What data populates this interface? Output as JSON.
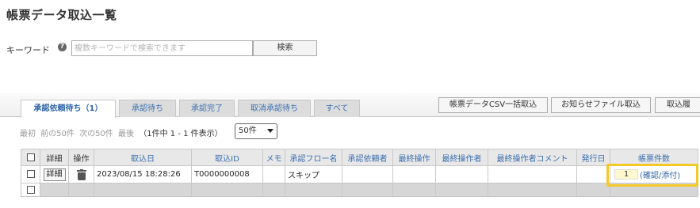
{
  "page": {
    "title": "帳票データ取込一覧"
  },
  "search": {
    "label": "キーワード",
    "help_icon": "?",
    "placeholder": "複数キーワードで検索できます",
    "button": "検索"
  },
  "tabs": [
    {
      "label": "承認依頼待ち（1）",
      "active": true
    },
    {
      "label": "承認待ち",
      "active": false
    },
    {
      "label": "承認完了",
      "active": false
    },
    {
      "label": "取消承認待ち",
      "active": false
    },
    {
      "label": "すべて",
      "active": false
    }
  ],
  "actions": [
    {
      "label": "帳票データCSV一括取込"
    },
    {
      "label": "お知らせファイル取込"
    },
    {
      "label": "取込履"
    }
  ],
  "pager": {
    "first": "最初",
    "prev": "前の50件",
    "next": "次の50件",
    "last": "最後",
    "info": "（1件中 1 - 1 件表示）",
    "per_page": "50件"
  },
  "table": {
    "columns": [
      "詳細",
      "操作",
      "取込日",
      "取込ID",
      "メモ",
      "承認フロー名",
      "承認依頼者",
      "最終操作",
      "最終操作者",
      "最終操作者コメント",
      "発行日",
      "帳票件数"
    ],
    "rows": [
      {
        "detail_button": "詳細",
        "action_icon": "trash-icon",
        "import_date": "2023/08/15 18:28:26",
        "import_id": "T0000000008",
        "memo": "",
        "flow_name": "スキップ",
        "requester": "",
        "last_action": "",
        "last_operator": "",
        "last_comment": "",
        "issue_date": "",
        "count": "1",
        "count_link": "(確認/添付)"
      }
    ]
  },
  "colors": {
    "highlight": "#f3c92a",
    "link": "#2d64a8"
  }
}
